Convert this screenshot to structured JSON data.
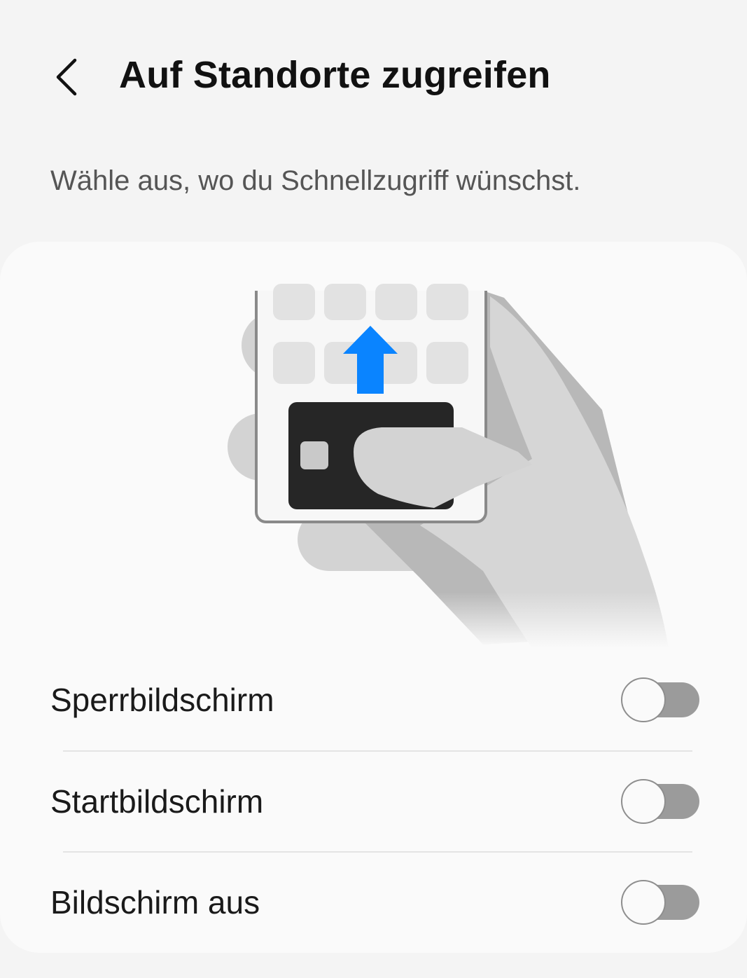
{
  "header": {
    "back_icon": "chevron-left-icon",
    "title": "Auf Standorte zugreifen"
  },
  "subtitle": "Wähle aus, wo du Schnellzugriff wünschst.",
  "illustration": {
    "description_icon": "phone-swipe-up-card-illustration",
    "arrow_color": "#0a84ff"
  },
  "options": [
    {
      "label": "Sperrbildschirm",
      "enabled": false
    },
    {
      "label": "Startbildschirm",
      "enabled": false
    },
    {
      "label": "Bildschirm aus",
      "enabled": false
    }
  ]
}
